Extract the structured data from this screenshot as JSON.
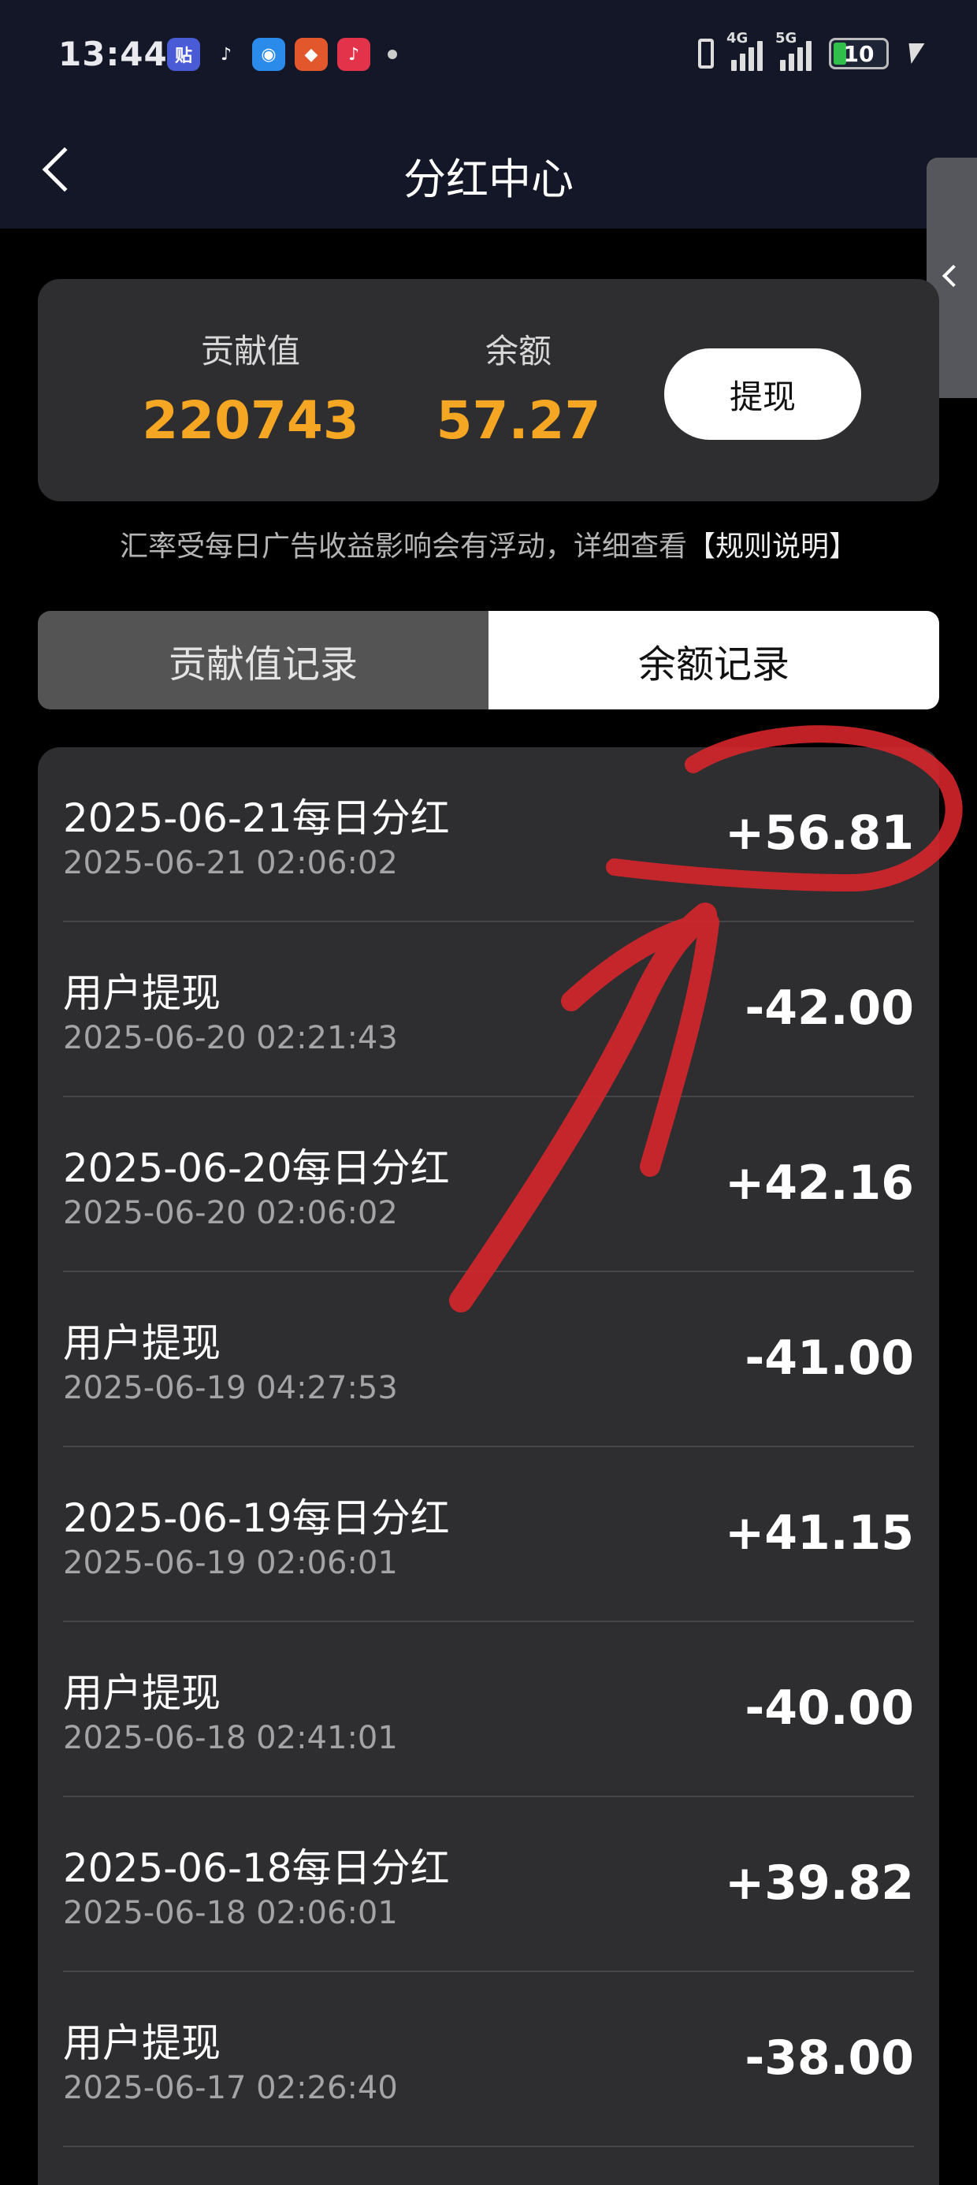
{
  "status_bar": {
    "time": "13:44",
    "app_icons": [
      {
        "icon": "tieba-icon",
        "glyph": "贴",
        "color": "#4a5bd6"
      },
      {
        "icon": "tiktok-icon",
        "glyph": "♪",
        "color": "#141727"
      },
      {
        "icon": "wifi-app-icon",
        "glyph": "◉",
        "color": "#2b8bea"
      },
      {
        "icon": "shop-app-icon",
        "glyph": "◆",
        "color": "#e2572b"
      },
      {
        "icon": "tiktok-lite-icon",
        "glyph": "♪",
        "color": "#e2334a"
      }
    ],
    "network_1": "4G",
    "network_2": "5G",
    "battery_level": "10"
  },
  "nav": {
    "title": "分红中心"
  },
  "summary": {
    "contribution_label": "贡献值",
    "contribution_value": "220743",
    "balance_label": "余额",
    "balance_value": "57.27",
    "withdraw_label": "提现",
    "accent_color": "#f5a623"
  },
  "notice": {
    "text": "汇率受每日广告收益影响会有浮动，详细查看",
    "link": "【规则说明】"
  },
  "tabs": [
    {
      "label": "贡献值记录",
      "active": false
    },
    {
      "label": "余额记录",
      "active": true
    }
  ],
  "records": [
    {
      "title": "2025-06-21每日分红",
      "time": "2025-06-21 02:06:02",
      "amount": "+56.81"
    },
    {
      "title": "用户提现",
      "time": "2025-06-20 02:21:43",
      "amount": "-42.00"
    },
    {
      "title": "2025-06-20每日分红",
      "time": "2025-06-20 02:06:02",
      "amount": "+42.16"
    },
    {
      "title": "用户提现",
      "time": "2025-06-19 04:27:53",
      "amount": "-41.00"
    },
    {
      "title": "2025-06-19每日分红",
      "time": "2025-06-19 02:06:01",
      "amount": "+41.15"
    },
    {
      "title": "用户提现",
      "time": "2025-06-18 02:41:01",
      "amount": "-40.00"
    },
    {
      "title": "2025-06-18每日分红",
      "time": "2025-06-18 02:06:01",
      "amount": "+39.82"
    },
    {
      "title": "用户提现",
      "time": "2025-06-17 02:26:40",
      "amount": "-38.00"
    }
  ],
  "annotation_color": "#d9262b"
}
